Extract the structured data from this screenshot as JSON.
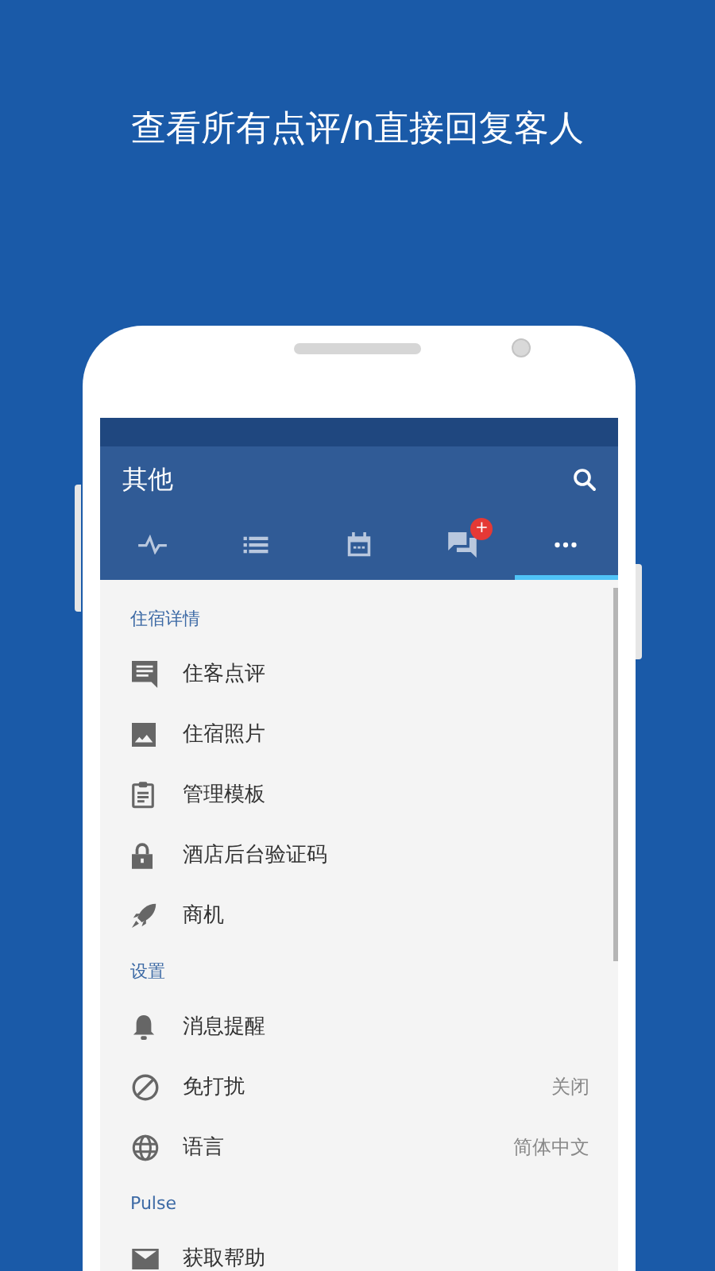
{
  "headline": "查看所有点评/n直接回复客人",
  "app_bar": {
    "title": "其他"
  },
  "tabs": [
    {
      "kind": "pulse",
      "selected": false
    },
    {
      "kind": "list",
      "selected": false
    },
    {
      "kind": "calendar",
      "selected": false
    },
    {
      "kind": "chat",
      "selected": false,
      "badge": "+"
    },
    {
      "kind": "more",
      "selected": true
    }
  ],
  "sections": [
    {
      "header": "住宿详情",
      "items": [
        {
          "kind": "comment",
          "label": "住客点评"
        },
        {
          "kind": "image",
          "label": "住宿照片"
        },
        {
          "kind": "clipboard",
          "label": "管理模板"
        },
        {
          "kind": "lock",
          "label": "酒店后台验证码"
        },
        {
          "kind": "rocket",
          "label": "商机"
        }
      ]
    },
    {
      "header": "设置",
      "items": [
        {
          "kind": "bell",
          "label": "消息提醒"
        },
        {
          "kind": "block",
          "label": "免打扰",
          "value": "关闭"
        },
        {
          "kind": "globe",
          "label": "语言",
          "value": "简体中文"
        }
      ]
    },
    {
      "header": "Pulse",
      "items": [
        {
          "kind": "mail",
          "label": "获取帮助"
        }
      ]
    }
  ]
}
